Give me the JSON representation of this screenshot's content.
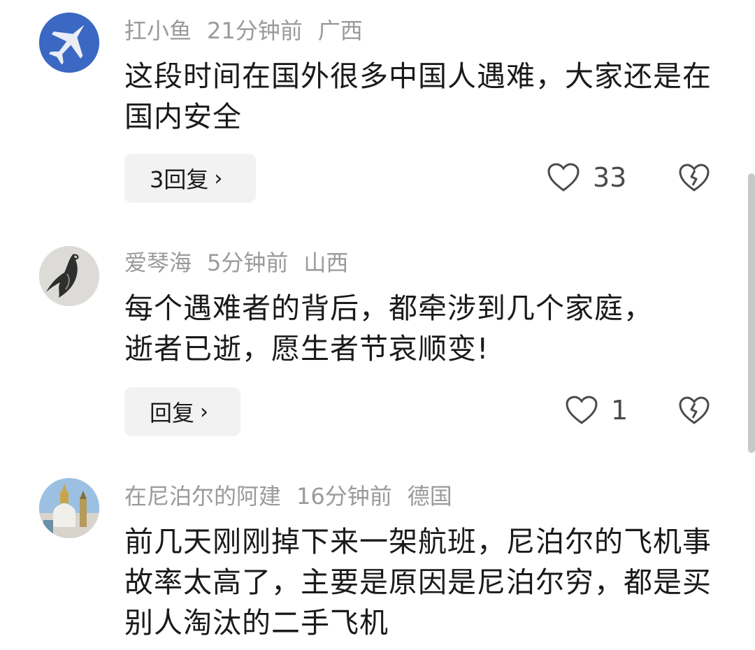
{
  "comments": [
    {
      "username": "扛小鱼",
      "time": "21分钟前",
      "location": "广西",
      "text": "这段时间在国外很多中国人遇难，大家还是在国内安全",
      "reply_label": "3回复",
      "likes": "33",
      "avatar_icon": "fighter-jet-icon"
    },
    {
      "username": "爱琴海",
      "time": "5分钟前",
      "location": "山西",
      "text": "每个遇难者的背后，都牵涉到几个家庭，逝者已逝，愿生者节哀顺变!",
      "reply_label": "回复",
      "likes": "1",
      "avatar_icon": "eagle-icon"
    },
    {
      "username": "在尼泊尔的阿建",
      "time": "16分钟前",
      "location": "德国",
      "text": "前几天刚刚掉下来一架航班，尼泊尔的飞机事故率太高了，主要是原因是尼泊尔穷，都是买别人淘汰的二手飞机",
      "avatar_icon": "stupa-icon"
    }
  ],
  "icons": {
    "reply_chevron": "chevron-right-icon",
    "like": "heart-outline-icon",
    "dislike": "broken-heart-icon"
  },
  "colors": {
    "meta_text": "#9a9a9a",
    "body_text": "#1a1a1a",
    "reply_bg": "#f2f2f2"
  }
}
